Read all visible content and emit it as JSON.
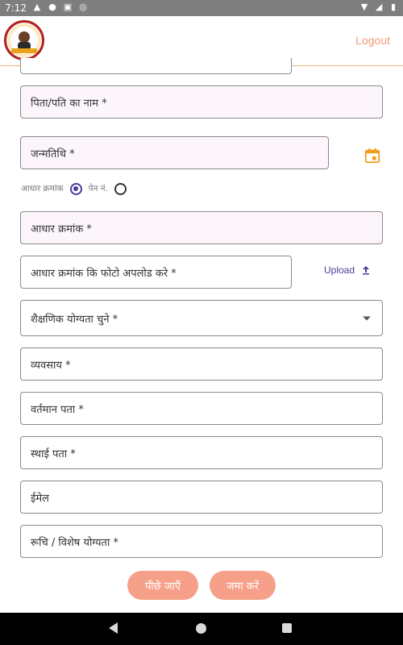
{
  "status_bar": {
    "time": "7:12",
    "left_icons": [
      "warning-icon",
      "location-icon",
      "image-icon",
      "data-saver-icon"
    ],
    "right_icons": [
      "wifi-icon",
      "signal-icon",
      "battery-icon"
    ]
  },
  "header": {
    "logout_label": "Logout"
  },
  "form": {
    "father_husband_name": "पिता/पति का नाम  *",
    "dob": "जन्मतिथि *",
    "id_type": {
      "aadhaar_label": "आधार क्रमांक",
      "pan_label": "पेन नं.",
      "selected": "aadhaar"
    },
    "aadhaar_number": "आधार क्रमांक *",
    "aadhaar_photo": "आधार क्रमांक कि फोटो अपलोड करे  *",
    "upload_label": "Upload",
    "education": "शैक्षणिक योग्यता चुने *",
    "occupation": "व्यवसाय *",
    "current_address": "वर्तमान पता *",
    "permanent_address": "स्थाई पता *",
    "email": "ईमेल",
    "interest": "रूचि / विशेष योग्यता *"
  },
  "buttons": {
    "back": "पीछे जाएँ",
    "submit": "जमा करें"
  },
  "colors": {
    "accent_orange": "#f29a73",
    "button_orange": "#f6a08a",
    "radio_purple": "#4b3b9b",
    "calendar_orange": "#f39c1f"
  }
}
